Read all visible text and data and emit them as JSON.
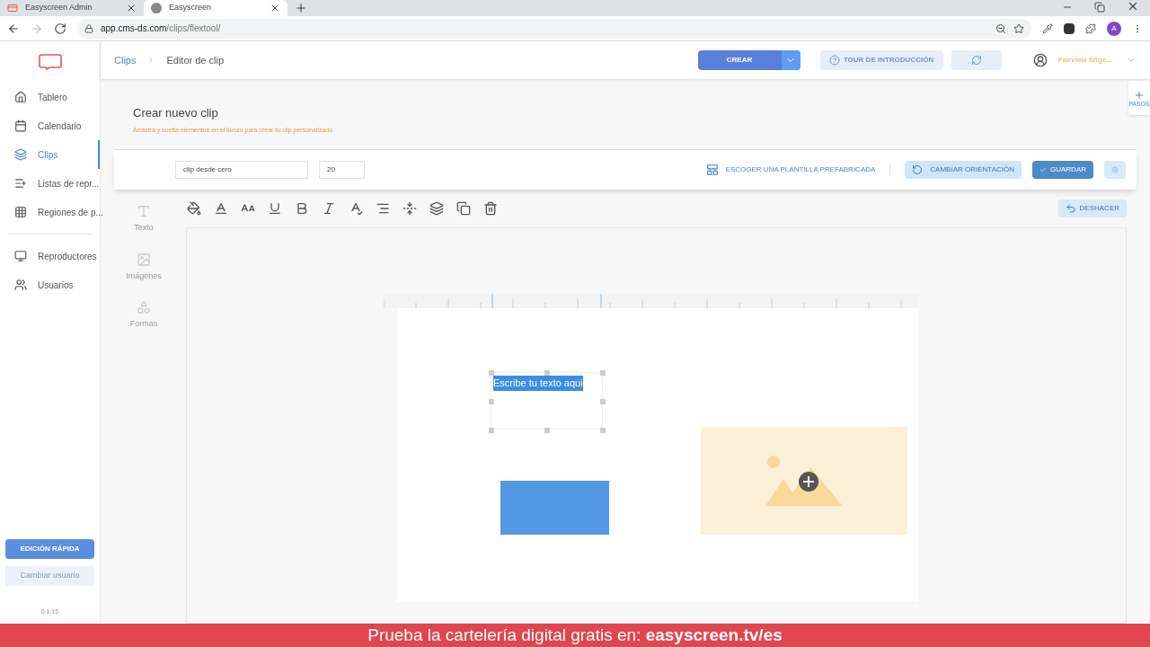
{
  "browser": {
    "tabs": [
      {
        "title": "Easyscreen Admin",
        "selected": false
      },
      {
        "title": "Easyscreen",
        "selected": true
      }
    ],
    "url_host": "app.cms-ds.com",
    "url_path": "/clips/flextool/",
    "profile_initial": "A"
  },
  "sidebar": {
    "items": [
      {
        "label": "Tablero",
        "selected": false
      },
      {
        "label": "Calendario",
        "selected": false
      },
      {
        "label": "Clips",
        "selected": true
      },
      {
        "label": "Listas de repr...",
        "selected": false
      },
      {
        "label": "Regiones de p...",
        "selected": false
      },
      {
        "label": "Reproductores",
        "selected": false
      },
      {
        "label": "Usuarios",
        "selected": false
      }
    ],
    "quick_edit": "EDICIÓN RÁPIDA",
    "change_user": "Cambiar usuario",
    "version": "0.1.15"
  },
  "header": {
    "breadcrumbs": [
      "Clips",
      "Editor de clip"
    ],
    "create": "CREAR",
    "tour": "TOUR DE INTRODUCCIÓN",
    "user": "Fairview Sitge...",
    "steps": "PASOS"
  },
  "page": {
    "title": "Crear nuevo clip",
    "subtitle": "Arrastra y suelta elementos en el lienzo para crear tu clip personalizado"
  },
  "clip_form": {
    "name": "clip desde cero",
    "duration": "20",
    "template": "ESCOGER UNA PLANTILLA PREFABRICADA",
    "orientation": "CAMBIAR ORIENTACIÓN",
    "save": "GUARDAR"
  },
  "tools": [
    "Texto",
    "Imágenes",
    "Formas"
  ],
  "undo": "DESHACER",
  "canvas": {
    "text": "Escribe tu texto aqui"
  },
  "banner": {
    "text": "Prueba la cartelería digital gratis en: ",
    "link": "easyscreen.tv/es"
  }
}
